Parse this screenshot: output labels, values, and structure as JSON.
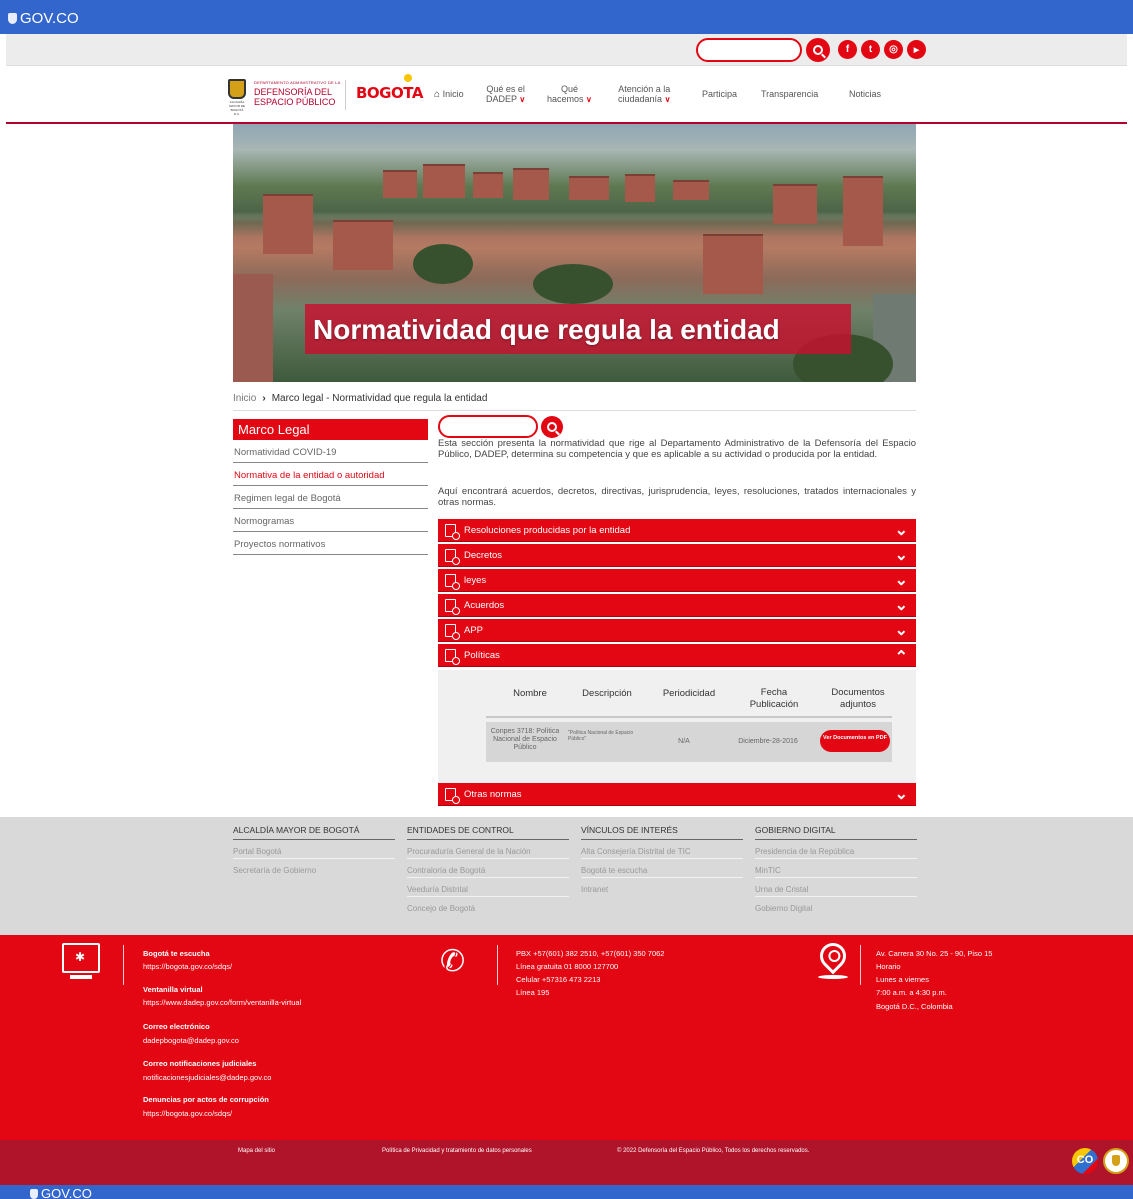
{
  "gov_bar": {
    "logo_text": "GOV.CO"
  },
  "social": [
    {
      "icon": "facebook-icon",
      "glyph": "f"
    },
    {
      "icon": "twitter-icon",
      "glyph": "t"
    },
    {
      "icon": "instagram-icon",
      "glyph": "◎"
    },
    {
      "icon": "youtube-icon",
      "glyph": "▶"
    }
  ],
  "header": {
    "escudo_text": "ALCALDÍA MAYOR DE BOGOTÁ D.C.",
    "dadep_small": "DEPARTAMENTO ADMINISTRATIVO DE LA",
    "dadep_line1": "DEFENSORÍA DEL",
    "dadep_line2": "ESPACIO PÚBLICO",
    "bogota": "BOGOTA"
  },
  "nav": {
    "home": "Inicio",
    "dadep_l1": "Qué es el",
    "dadep_l2": "DADEP",
    "hacemos_l1": "Qué",
    "hacemos_l2": "hacemos",
    "atencion_l1": "Atención a la",
    "atencion_l2": "ciudadanía",
    "participa": "Participa",
    "transparencia": "Transparencia",
    "noticias": "Noticias"
  },
  "banner": {
    "title": "Normatividad que regula la entidad"
  },
  "breadcrumb": {
    "home": "Inicio",
    "current": "Marco legal - Normatividad que regula la entidad"
  },
  "sidebar": {
    "heading": "Marco Legal",
    "items": [
      "Normatividad COVID-19",
      "Normativa de la entidad o autoridad",
      "Regimen legal de Bogotá",
      "Normogramas",
      "Proyectos normativos"
    ]
  },
  "content": {
    "intro": "Esta sección presenta la normatividad que rige al Departamento Administrativo de la Defensoría del Espacio Público, DADEP, determina su competencia y que es aplicable a su actividad o producida por la entidad.",
    "intro2": "Aquí encontrará acuerdos, decretos, directivas, jurisprudencia, leyes, resoluciones, tratados internacionales y otras normas.",
    "accordion": [
      "Resoluciones producidas por la entidad",
      "Decretos",
      "leyes",
      "Acuerdos",
      "APP",
      "Políticas",
      "Otras normas"
    ],
    "table": {
      "headers": [
        "Nombre",
        "Descripción",
        "Periodicidad",
        "Fecha Publicación",
        "Documentos adjuntos"
      ],
      "row": {
        "nombre": "Conpes 3718: Política Nacional de Espacio Público",
        "descripcion": "\"Política Nacional de Espacio Público\"",
        "periodicidad": "N/A",
        "fecha": "Diciembre-28-2016",
        "button": "Ver Documentos en PDF"
      }
    }
  },
  "footer_links": [
    {
      "title": "ALCALDÍA MAYOR DE BOGOTÁ",
      "links": [
        "Portal Bogotá",
        "Secretaría de Gobierno"
      ]
    },
    {
      "title": "ENTIDADES DE CONTROL",
      "links": [
        "Procuraduría General de la Nación",
        "Contraloría de Bogotá",
        "Veeduría Distrital",
        "Concejo de Bogotá"
      ]
    },
    {
      "title": "VÍNCULOS DE INTERÉS",
      "links": [
        "Alta Consejería Distrital de TIC",
        "Bogotá te escucha",
        "Intranet"
      ]
    },
    {
      "title": "GOBIERNO DIGITAL",
      "links": [
        "Presidencia de la República",
        "MinTIC",
        "Urna de Cristal",
        "Gobierno Digital"
      ]
    }
  ],
  "contact": {
    "items": [
      {
        "label": "Bogotá te escucha",
        "value": "https://bogota.gov.co/sdqs/"
      },
      {
        "label": "Ventanilla virtual",
        "value": "https://www.dadep.gov.co/form/ventanilla-virtual"
      },
      {
        "label": "Correo electrónico",
        "value": "dadepbogota@dadep.gov.co"
      },
      {
        "label": "Correo notificaciones judiciales",
        "value": "notificacionesjudiciales@dadep.gov.co"
      },
      {
        "label": "Denuncias por actos de corrupción",
        "value": "https://bogota.gov.co/sdqs/"
      }
    ],
    "phone": [
      "PBX +57(601) 382 2510, +57(601) 350 7062",
      "Línea gratuita 01 8000 127700",
      "Celular +57316 473 2213",
      "Línea 195"
    ],
    "address": [
      "Av. Carrera 30 No. 25 - 90, Piso 15",
      "Horario",
      "Lunes a viernes",
      "7:00 a.m. a 4:30 p.m.",
      "Bogotá D.C., Colombia"
    ]
  },
  "bottom": {
    "mapa": "Mapa del sitio",
    "politica": "Política de Privacidad y tratamiento de datos personales",
    "copyright": "© 2022 Defensoría del Espacio Público, Todos los derechos reservados.",
    "co": "CO"
  },
  "colors": {
    "gov_blue": "#3366cc",
    "brand_red": "#e30613",
    "dark_red": "#b0142a"
  }
}
